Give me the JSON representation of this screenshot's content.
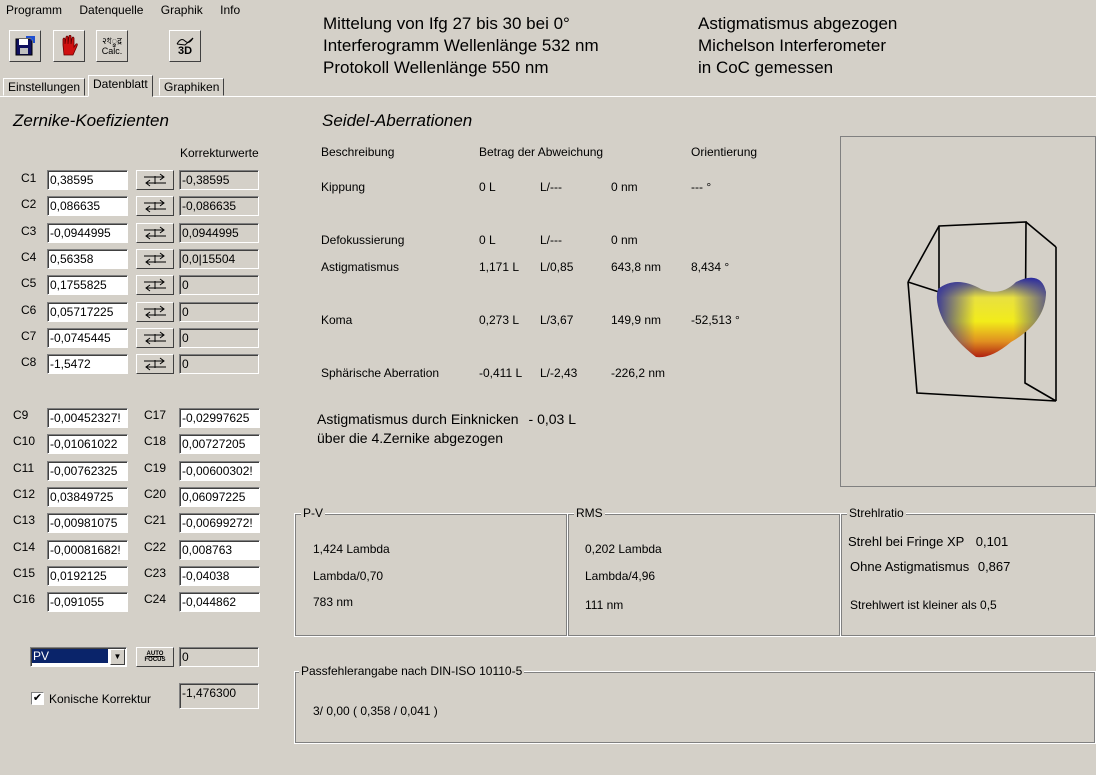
{
  "menu": [
    "Programm",
    "Datenquelle",
    "Graphik",
    "Info"
  ],
  "toolbar": {
    "calc_label_top": "२ধ्रुद्र",
    "calc_label": "Calc.",
    "threed_label": "3D"
  },
  "header": {
    "left": [
      "Mittelung von Ifg 27 bis 30 bei 0°",
      "Interferogramm Wellenlänge 532 nm",
      "Protokoll Wellenlänge 550 nm"
    ],
    "right": [
      "Astigmatismus abgezogen",
      "Michelson Interferometer",
      "in CoC gemessen"
    ]
  },
  "tabs": [
    "Einstellungen",
    "Datenblatt",
    "Graphiken"
  ],
  "zernike": {
    "title": "Zernike-Koefizienten",
    "korrektur_header": "Korrekturwerte",
    "rows": [
      {
        "label": "C1",
        "value": "0,38595",
        "korr": "-0,38595"
      },
      {
        "label": "C2",
        "value": "0,086635",
        "korr": "-0,086635"
      },
      {
        "label": "C3",
        "value": "-0,0944995",
        "korr": "0,0944995"
      },
      {
        "label": "C4",
        "value": "0,56358",
        "korr": "0,0|15504"
      },
      {
        "label": "C5",
        "value": "0,1755825",
        "korr": "0"
      },
      {
        "label": "C6",
        "value": "0,05717225",
        "korr": "0"
      },
      {
        "label": "C7",
        "value": "-0,0745445",
        "korr": "0"
      },
      {
        "label": "C8",
        "value": "-1,5472",
        "korr": "0"
      }
    ],
    "left_col": [
      {
        "label": "C9",
        "value": "-0,00452327!"
      },
      {
        "label": "C10",
        "value": "-0,01061022"
      },
      {
        "label": "C11",
        "value": "-0,00762325"
      },
      {
        "label": "C12",
        "value": "0,03849725"
      },
      {
        "label": "C13",
        "value": "-0,00981075"
      },
      {
        "label": "C14",
        "value": "-0,00081682!"
      },
      {
        "label": "C15",
        "value": "0,0192125"
      },
      {
        "label": "C16",
        "value": "-0,091055"
      }
    ],
    "right_col": [
      {
        "label": "C17",
        "value": "-0,02997625"
      },
      {
        "label": "C18",
        "value": "0,00727205"
      },
      {
        "label": "C19",
        "value": "-0,00600302!"
      },
      {
        "label": "C20",
        "value": "0,06097225"
      },
      {
        "label": "C21",
        "value": "-0,00699272!"
      },
      {
        "label": "C22",
        "value": "0,008763"
      },
      {
        "label": "C23",
        "value": "-0,04038"
      },
      {
        "label": "C24",
        "value": "-0,044862"
      }
    ],
    "select_value": "PV",
    "autofocus_label_top": "AUTO",
    "autofocus_label": "FOCUS",
    "autofocus_value": "0",
    "konisch_label": "Konische Korrektur",
    "konisch_checked": true,
    "konisch_value": "-1,476300"
  },
  "seidel": {
    "title": "Seidel-Aberrationen",
    "headers": [
      "Beschreibung",
      "Betrag der Abweichung",
      "Orientierung"
    ],
    "rows": [
      {
        "name": "Kippung",
        "l": "0 L",
        "ratio": "L/---",
        "nm": "0 nm",
        "orient": "--- °"
      },
      {
        "name": "Defokussierung",
        "l": "0 L",
        "ratio": "L/---",
        "nm": "0 nm",
        "orient": ""
      },
      {
        "name": "Astigmatismus",
        "l": "1,171 L",
        "ratio": "L/0,85",
        "nm": "643,8 nm",
        "orient": "8,434 °"
      },
      {
        "name": "Koma",
        "l": "0,273 L",
        "ratio": "L/3,67",
        "nm": "149,9 nm",
        "orient": "-52,513 °"
      },
      {
        "name": "Sphärische Aberration",
        "l": "-0,411 L",
        "ratio": "L/-2,43",
        "nm": "-226,2 nm",
        "orient": ""
      }
    ],
    "note_line1": "Astigmatismus durch Einknicken",
    "note_value": "- 0,03 L",
    "note_line2": "über die 4.Zernike abgezogen"
  },
  "pv": {
    "title": "P-V",
    "lines": [
      "1,424 Lambda",
      "Lambda/0,70",
      "783 nm"
    ]
  },
  "rms": {
    "title": "RMS",
    "lines": [
      "0,202 Lambda",
      "Lambda/4,96",
      "111 nm"
    ]
  },
  "strehl": {
    "title": "Strehlratio",
    "line1_label": "Strehl bei Fringe XP",
    "line1_value": "0,101",
    "line2_label": "Ohne Astigmatismus",
    "line2_value": "0,867",
    "note": "Strehlwert ist kleiner als 0,5"
  },
  "pass": {
    "title": "Passfehlerangabe nach DIN-ISO 10110-5",
    "value": "3/  0,00 ( 0,358 / 0,041 )"
  },
  "colors": {
    "bg": "#d4d0c8",
    "surface_blue": "#2a2aa0",
    "surface_yellow": "#f2ec1a",
    "surface_red": "#b02010"
  }
}
